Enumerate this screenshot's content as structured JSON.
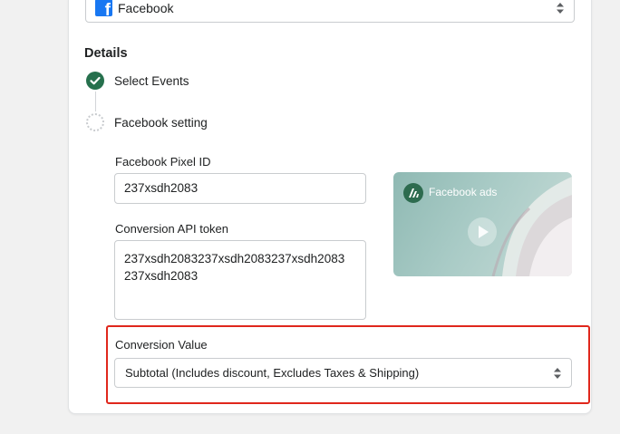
{
  "channel_select": {
    "value": "Facebook",
    "icon": "facebook-icon"
  },
  "details": {
    "title": "Details",
    "steps": [
      {
        "label": "Select Events",
        "status": "completed"
      },
      {
        "label": "Facebook setting",
        "status": "in-progress"
      }
    ]
  },
  "facebook_setting": {
    "pixel_id_label": "Facebook Pixel ID",
    "pixel_id_value": "237xsdh2083",
    "token_label": "Conversion API token",
    "token_value": "237xsdh2083237xsdh2083237xsdh2083237xsdh2083",
    "video": {
      "title": "Facebook ads",
      "icon": "play-icon"
    }
  },
  "conversion_value": {
    "label": "Conversion Value",
    "selected": "Subtotal (Includes discount, Excludes Taxes & Shipping)"
  },
  "colors": {
    "accent_green": "#26704d",
    "highlight_red": "#e0271c",
    "facebook_blue": "#1877f2"
  }
}
